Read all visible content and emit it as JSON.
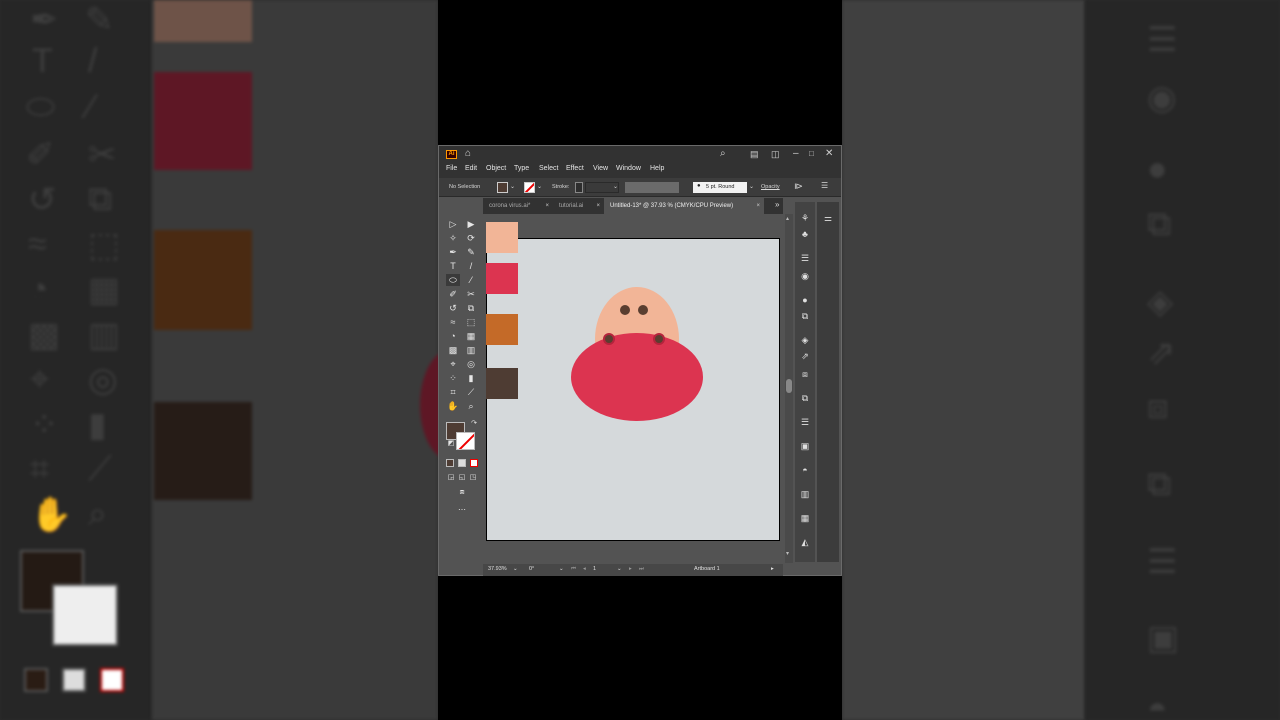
{
  "app": {
    "logo_text": "Ai",
    "menus": [
      "File",
      "Edit",
      "Object",
      "Type",
      "Select",
      "Effect",
      "View",
      "Window",
      "Help"
    ]
  },
  "control_bar": {
    "selection_label": "No Selection",
    "stroke_label": "Stroke:",
    "brush_label": "5 pt. Round",
    "opacity_label": "Opacity"
  },
  "tabs": [
    {
      "label": "corona virus.ai*"
    },
    {
      "label": "tutorial.ai"
    },
    {
      "label": "Untitled-13* @ 37.93 % (CMYK/CPU Preview)"
    }
  ],
  "status": {
    "zoom": "37.93%",
    "rotation": "0°",
    "artboard_number": "1",
    "artboard_name": "Artboard 1"
  },
  "swatches": {
    "peach": "#f2b597",
    "red": "#dc3450",
    "orange": "#c46a28",
    "brown": "#4e3c33"
  },
  "icons": {
    "search": "search-icon",
    "home": "home-icon",
    "minimize": "minimize-icon",
    "maximize": "maximize-icon",
    "close": "close-icon"
  }
}
